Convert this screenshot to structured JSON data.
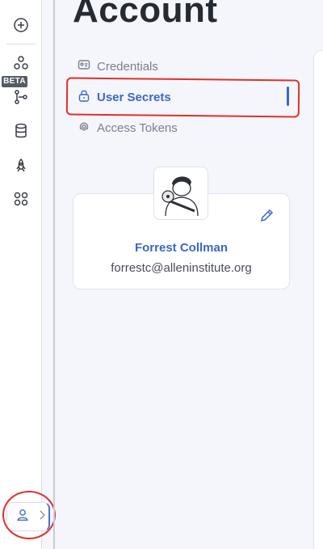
{
  "page": {
    "title": "Account"
  },
  "rail": {
    "beta_label": "BETA",
    "icons": [
      "add-icon",
      "shapes-icon",
      "workflow-icon",
      "database-icon",
      "rocket-icon",
      "apps-grid-icon",
      "user-icon",
      "chevron-right-icon"
    ]
  },
  "nav": {
    "items": [
      {
        "label": "Credentials",
        "icon": "id-card-icon",
        "active": false
      },
      {
        "label": "User Secrets",
        "icon": "lock-icon",
        "active": true
      },
      {
        "label": "Access Tokens",
        "icon": "fingerprint-icon",
        "active": false
      }
    ]
  },
  "profile": {
    "name": "Forrest Collman",
    "email": "forrestc@alleninstitute.org"
  },
  "colors": {
    "accent": "#3c66c9",
    "annotation": "#e0302c",
    "background": "#f4f6fb"
  }
}
